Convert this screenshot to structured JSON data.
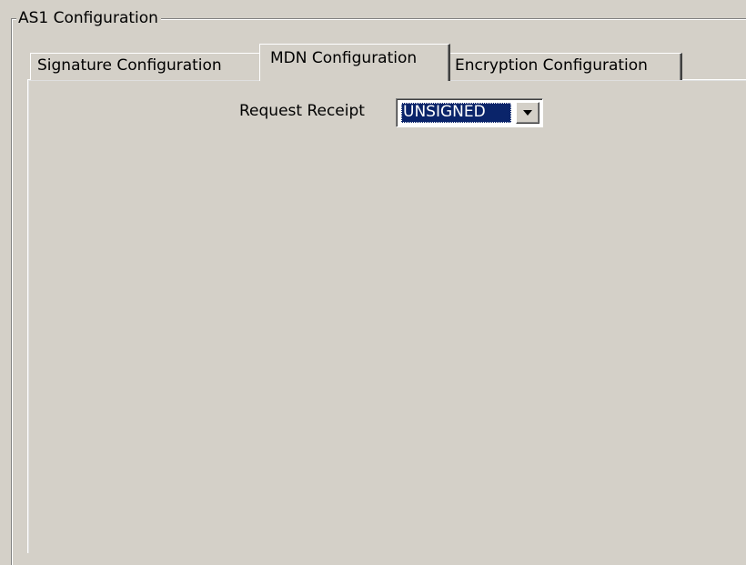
{
  "group": {
    "title": "AS1 Configuration"
  },
  "tabs": [
    {
      "label": "Signature Configuration",
      "active": false
    },
    {
      "label": "MDN Configuration",
      "active": true
    },
    {
      "label": "Encryption Configuration",
      "active": false
    }
  ],
  "mdn": {
    "request_receipt_label": "Request Receipt",
    "request_receipt_value": "UNSIGNED"
  },
  "icons": {
    "dropdown": "chevron-down-icon"
  },
  "colors": {
    "window_background": "#d4d0c8",
    "selection_background": "#0a246a",
    "selection_text": "#ffffff"
  }
}
